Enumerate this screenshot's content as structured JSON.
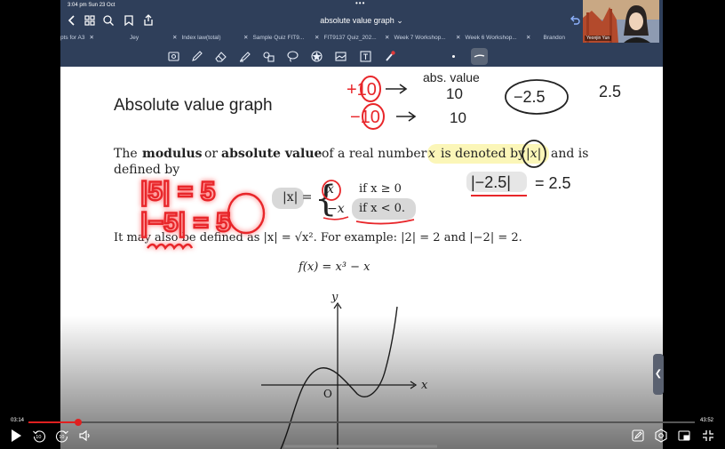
{
  "status_bar": {
    "time_date": "3:04 pm  Sun 23 Oct"
  },
  "titlebar": {
    "title": "absolute value graph ⌄"
  },
  "tabs": [
    "pts for A3",
    "Jey",
    "Index law(total)",
    "Sample Quiz FIT9...",
    "FIT9137 Quiz_202...",
    "Week 7 Workshop...",
    "Week 6 Workshop...",
    "Brandon"
  ],
  "toolbar": {
    "tools": [
      "scan-icon",
      "pen-icon",
      "eraser-icon",
      "highlighter-icon",
      "shapes-icon",
      "lasso-icon",
      "sticker-icon",
      "image-icon",
      "textbox-icon",
      "laser-pointer-icon",
      "dot-icon",
      "stroke-icon"
    ]
  },
  "webcam": {
    "name": "Yeonjin Yun"
  },
  "document": {
    "section_title": "Absolute value graph",
    "para1_the": "The",
    "para1_modulus": "modulus",
    "para1_or": "or",
    "para1_absval": "absolute value",
    "para1_rest": "of a real number",
    "para1_x": "x",
    "para1_denoted": "is denoted by",
    "para1_absx": "|x|",
    "para1_andis": "and is",
    "para1_line2": "defined by",
    "piece_lhs": "|x| =",
    "piece_case1_val": "x",
    "piece_case1_cond": "if x ≥ 0",
    "piece_case2_val": "−x",
    "piece_case2_cond": "if x < 0.",
    "para2": "It may also be defined as |x| = √x². For example: |2| = 2 and |−2| = 2.",
    "func": "f(x) = x³ − x",
    "axis_y": "y",
    "axis_x": "x",
    "origin": "O"
  },
  "handwriting": {
    "abs_value": "abs. value",
    "plus10": "+10",
    "minus10": "−10",
    "ten_a": "10",
    "ten_b": "10",
    "neg25": "−2.5",
    "pos25": "2.5",
    "abs_neg25": "|−2.5|",
    "eq25": "= 2.5",
    "abs5": "|5| = 5",
    "absneg5": "|−5| = 5"
  },
  "playback": {
    "current_time": "03:14",
    "total_time": "43:52",
    "progress": 0.074,
    "skip_back": "10",
    "skip_fwd": "10"
  },
  "colors": {
    "chrome": "#2f3f5a",
    "accent_red": "#e02020",
    "ink_red": "#e8262a",
    "highlight_yellow": "#fbf6b8"
  }
}
